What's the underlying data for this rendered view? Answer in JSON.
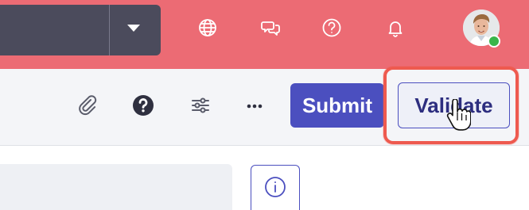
{
  "header": {
    "background_color": "#ec6b74",
    "dropdown": {
      "value": "",
      "caret_icon": "chevron-down-icon"
    },
    "icons": [
      "globe-icon",
      "chat-icon",
      "help-icon",
      "bell-icon"
    ],
    "user": {
      "avatar": "avatar",
      "status": "online",
      "status_color": "#39b54a"
    }
  },
  "toolbar": {
    "icons": [
      "paperclip-icon",
      "question-circle-icon",
      "sliders-icon",
      "more-icon"
    ],
    "submit_label": "Submit",
    "validate_label": "Validate",
    "accent_color": "#4b4fbf",
    "highlight_color": "#ee5a4f"
  },
  "content": {
    "info_icon": "info-icon"
  }
}
